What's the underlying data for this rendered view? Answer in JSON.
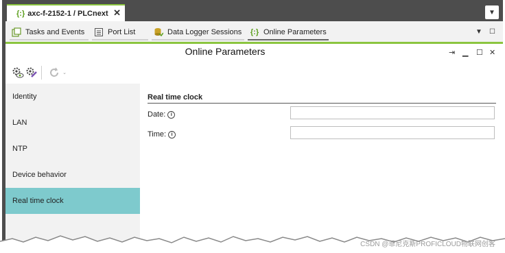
{
  "document_tab": {
    "icon": "braces-icon",
    "title": "axc-f-2152-1 / PLCnext",
    "close": "✕"
  },
  "toolbar": {
    "tabs": [
      {
        "label": "Tasks and Events"
      },
      {
        "label": "Port List"
      },
      {
        "label": "Data Logger Sessions"
      },
      {
        "label": "Online Parameters"
      }
    ]
  },
  "content": {
    "title": "Online Parameters"
  },
  "nav": {
    "items": [
      {
        "label": "Identity"
      },
      {
        "label": "LAN"
      },
      {
        "label": "NTP"
      },
      {
        "label": "Device behavior"
      },
      {
        "label": "Real time clock"
      }
    ],
    "selected": "Real time clock"
  },
  "detail": {
    "section_title": "Real time clock",
    "fields": [
      {
        "label": "Date:",
        "value": ""
      },
      {
        "label": "Time:",
        "value": ""
      }
    ]
  },
  "watermark": "CSDN @菲尼克斯PROFICLOUD物联网创客",
  "colors": {
    "accent_green": "#8bc53f",
    "selected_nav": "#7ecacd",
    "frame_dark": "#4d4d4d"
  }
}
